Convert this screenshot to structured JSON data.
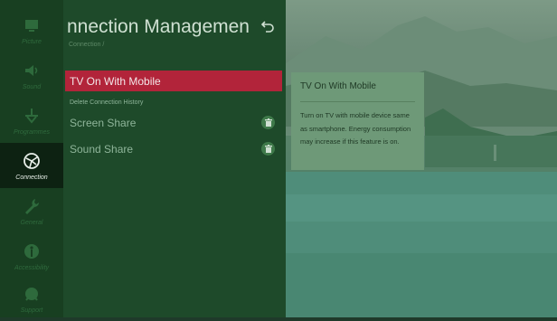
{
  "sidebar": {
    "items": [
      {
        "label": "Picture",
        "icon": "picture-icon",
        "active": false
      },
      {
        "label": "Sound",
        "icon": "speaker-icon",
        "active": false
      },
      {
        "label": "Programmes",
        "icon": "antenna-icon",
        "active": false
      },
      {
        "label": "Connection",
        "icon": "connection-icon",
        "active": true
      },
      {
        "label": "General",
        "icon": "wrench-icon",
        "active": false
      },
      {
        "label": "Accessibility",
        "icon": "accessibility-icon",
        "active": false
      },
      {
        "label": "Support",
        "icon": "support-icon",
        "active": false
      }
    ]
  },
  "panel": {
    "title": "nnection Managemen",
    "breadcrumb": "Connection /",
    "items": [
      {
        "label": "TV On With Mobile",
        "selected": true,
        "size": "normal"
      },
      {
        "label": "Delete Connection History",
        "selected": false,
        "size": "small"
      },
      {
        "label": "Screen Share",
        "selected": false,
        "size": "normal",
        "trash": true
      },
      {
        "label": "Sound Share",
        "selected": false,
        "size": "normal",
        "trash": true
      }
    ]
  },
  "tooltip": {
    "title": "TV On With Mobile",
    "body": "Turn on TV with mobile device same as smartphone. Energy consumption may increase if this feature is on."
  },
  "colors": {
    "accent": "#b2243a",
    "rail": "#183f21",
    "panel": "#1e4a2a"
  }
}
